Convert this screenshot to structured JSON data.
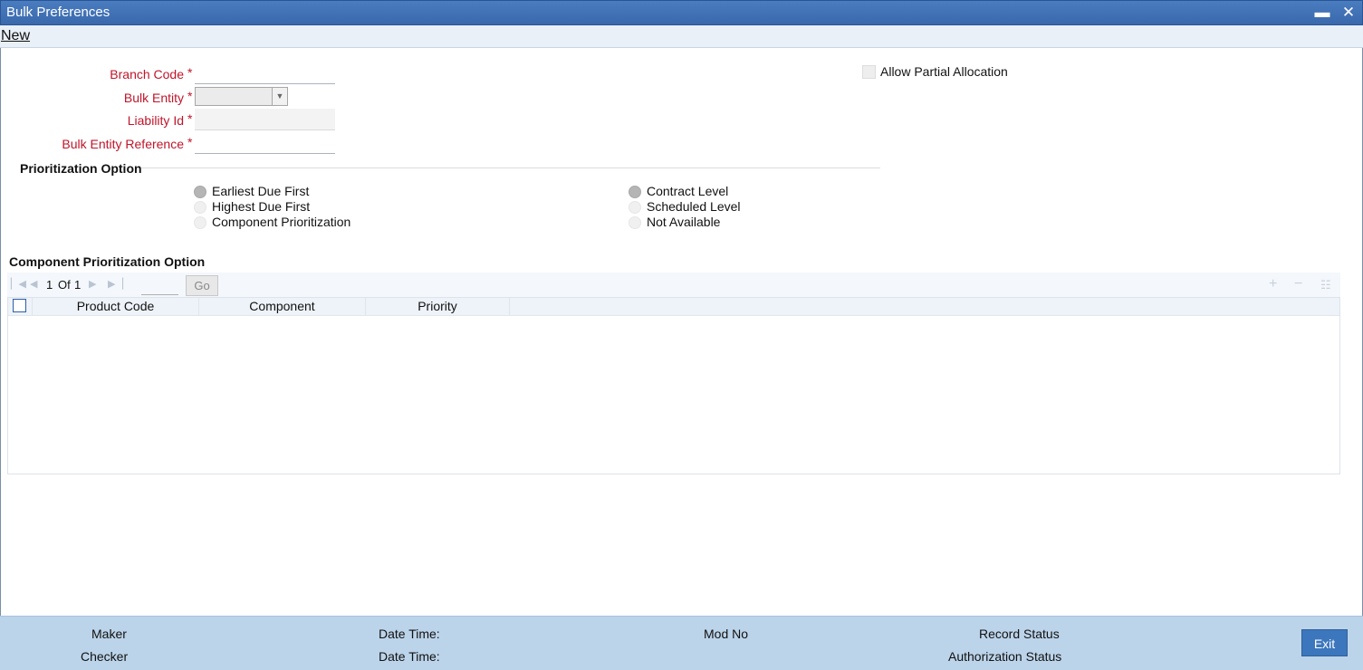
{
  "window": {
    "title": "Bulk Preferences",
    "minimize_glyph": "▬",
    "close_glyph": "✕"
  },
  "menu": {
    "new_label": "New"
  },
  "form": {
    "branch_code_label": "Branch Code",
    "bulk_entity_label": "Bulk Entity",
    "liability_id_label": "Liability Id",
    "bulk_entity_reference_label": "Bulk Entity Reference",
    "required_marker": "*",
    "branch_code_value": "",
    "bulk_entity_value": "",
    "liability_id_value": "",
    "bulk_entity_reference_value": "",
    "allow_partial_allocation_label": "Allow Partial Allocation",
    "allow_partial_allocation_checked": false
  },
  "prioritization": {
    "title": "Prioritization Option",
    "left_options": [
      {
        "label": "Earliest Due First",
        "selected": true
      },
      {
        "label": "Highest Due First",
        "selected": false
      },
      {
        "label": "Component Prioritization",
        "selected": false
      }
    ],
    "right_options": [
      {
        "label": "Contract Level",
        "selected": true
      },
      {
        "label": "Scheduled Level",
        "selected": false
      },
      {
        "label": "Not Available",
        "selected": false
      }
    ]
  },
  "component_grid": {
    "title": "Component Prioritization Option",
    "page_current": "1",
    "page_of": "Of",
    "page_total": "1",
    "go_label": "Go",
    "columns": [
      "Product Code",
      "Component",
      "Priority"
    ],
    "rows": []
  },
  "footer": {
    "maker_label": "Maker",
    "checker_label": "Checker",
    "datetime_label_1": "Date Time:",
    "datetime_label_2": "Date Time:",
    "modno_label": "Mod No",
    "record_status_label": "Record Status",
    "authorization_status_label": "Authorization Status",
    "exit_label": "Exit"
  }
}
